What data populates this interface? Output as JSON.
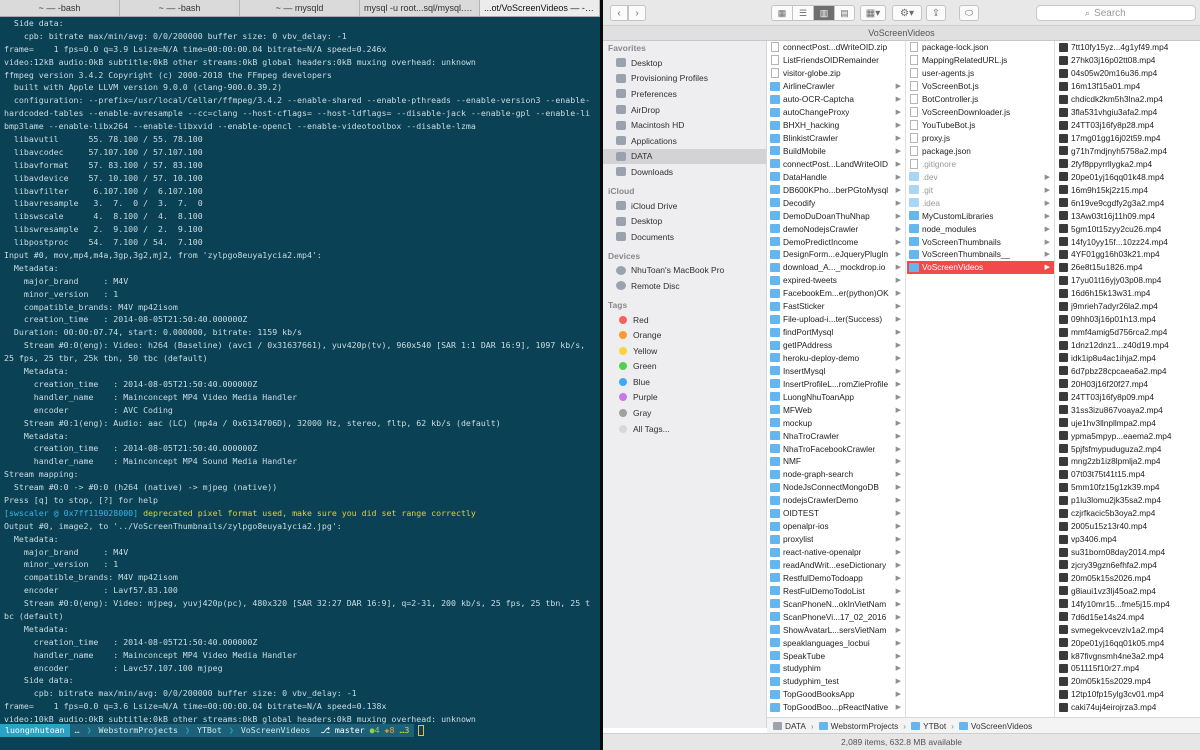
{
  "terminal": {
    "tabs": [
      "~ — -bash",
      "~ — -bash",
      "~ — mysqld",
      "mysql -u root...sql/mysql.sock",
      "...ot/VoScreenVideos — -bash"
    ],
    "lines": [
      "  Side data:",
      "    cpb: bitrate max/min/avg: 0/0/200000 buffer size: 0 vbv_delay: -1",
      "frame=    1 fps=0.0 q=3.9 Lsize=N/A time=00:00:00.04 bitrate=N/A speed=0.246x",
      "video:12kB audio:0kB subtitle:0kB other streams:0kB global headers:0kB muxing overhead: unknown",
      "ffmpeg version 3.4.2 Copyright (c) 2000-2018 the FFmpeg developers",
      "  built with Apple LLVM version 9.0.0 (clang-900.0.39.2)",
      "  configuration: --prefix=/usr/local/Cellar/ffmpeg/3.4.2 --enable-shared --enable-pthreads --enable-version3 --enable-",
      "hardcoded-tables --enable-avresample --cc=clang --host-cflags= --host-ldflags= --disable-jack --enable-gpl --enable-li",
      "bmp3lame --enable-libx264 --enable-libxvid --enable-opencl --enable-videotoolbox --disable-lzma",
      "  libavutil      55. 78.100 / 55. 78.100",
      "  libavcodec     57.107.100 / 57.107.100",
      "  libavformat    57. 83.100 / 57. 83.100",
      "  libavdevice    57. 10.100 / 57. 10.100",
      "  libavfilter     6.107.100 /  6.107.100",
      "  libavresample   3.  7.  0 /  3.  7.  0",
      "  libswscale      4.  8.100 /  4.  8.100",
      "  libswresample   2.  9.100 /  2.  9.100",
      "  libpostproc    54.  7.100 / 54.  7.100",
      "Input #0, mov,mp4,m4a,3gp,3g2,mj2, from 'zylpgo8euya1ycia2.mp4':",
      "  Metadata:",
      "    major_brand     : M4V",
      "    minor_version   : 1",
      "    compatible_brands: M4V mp42isom",
      "    creation_time   : 2014-08-05T21:50:40.000000Z",
      "  Duration: 00:00:07.74, start: 0.000000, bitrate: 1159 kb/s",
      "    Stream #0:0(eng): Video: h264 (Baseline) (avc1 / 0x31637661), yuv420p(tv), 960x540 [SAR 1:1 DAR 16:9], 1097 kb/s,",
      "25 fps, 25 tbr, 25k tbn, 50 tbc (default)",
      "    Metadata:",
      "      creation_time   : 2014-08-05T21:50:40.000000Z",
      "      handler_name    : Mainconcept MP4 Video Media Handler",
      "      encoder         : AVC Coding",
      "    Stream #0:1(eng): Audio: aac (LC) (mp4a / 0x6134706D), 32000 Hz, stereo, fltp, 62 kb/s (default)",
      "    Metadata:",
      "      creation_time   : 2014-08-05T21:50:40.000000Z",
      "      handler_name    : Mainconcept MP4 Sound Media Handler",
      "Stream mapping:",
      "  Stream #0:0 -> #0:0 (h264 (native) -> mjpeg (native))",
      "Press [q] to stop, [?] for help"
    ],
    "warn_prefix": "[swscaler @ 0x7ff119028000]",
    "warn_text": " deprecated pixel format used, make sure you did set range correctly",
    "lines2": [
      "Output #0, image2, to '../VoScreenThumbnails/zylpgo8euya1ycia2.jpg':",
      "  Metadata:",
      "    major_brand     : M4V",
      "    minor_version   : 1",
      "    compatible_brands: M4V mp42isom",
      "    encoder         : Lavf57.83.100",
      "    Stream #0:0(eng): Video: mjpeg, yuvj420p(pc), 480x320 [SAR 32:27 DAR 16:9], q=2-31, 200 kb/s, 25 fps, 25 tbn, 25 t",
      "bc (default)",
      "    Metadata:",
      "      creation_time   : 2014-08-05T21:50:40.000000Z",
      "      handler_name    : Mainconcept MP4 Video Media Handler",
      "      encoder         : Lavc57.107.100 mjpeg",
      "    Side data:",
      "      cpb: bitrate max/min/avg: 0/0/200000 buffer size: 0 vbv_delay: -1",
      "frame=    1 fps=0.0 q=3.6 Lsize=N/A time=00:00:00.04 bitrate=N/A speed=0.138x",
      "video:10kB audio:0kB subtitle:0kB other streams:0kB global headers:0kB muxing overhead: unknown"
    ],
    "prompt": {
      "user": "luongnhutoan",
      "path": [
        "…",
        "WebstormProjects",
        "YTBot",
        "VoScreenVideos"
      ],
      "branch": "master",
      "ok": "4",
      "mod": "8",
      "untracked": "3"
    }
  },
  "finder": {
    "window_title": "VoScreenVideos",
    "search_placeholder": "Search",
    "sidebar": {
      "favorites_label": "Favorites",
      "favorites": [
        "Desktop",
        "Provisioning Profiles",
        "Preferences",
        "AirDrop",
        "Macintosh HD",
        "Applications",
        "DATA",
        "Downloads"
      ],
      "icloud_label": "iCloud",
      "icloud": [
        "iCloud Drive",
        "Desktop",
        "Documents"
      ],
      "devices_label": "Devices",
      "devices": [
        "NhuToan's MacBook Pro",
        "Remote Disc"
      ],
      "tags_label": "Tags",
      "tags": [
        {
          "name": "Red",
          "color": "#fc605b"
        },
        {
          "name": "Orange",
          "color": "#fd9a30"
        },
        {
          "name": "Yellow",
          "color": "#fcd33c"
        },
        {
          "name": "Green",
          "color": "#4fd14f"
        },
        {
          "name": "Blue",
          "color": "#3fa9f5"
        },
        {
          "name": "Purple",
          "color": "#c57ae8"
        },
        {
          "name": "Gray",
          "color": "#a0a0a0"
        },
        {
          "name": "All Tags...",
          "color": "#d8d8d8"
        }
      ]
    },
    "col1": [
      {
        "n": "connectPost...dWriteOID.zip",
        "t": "file"
      },
      {
        "n": "ListFriendsOIDRemainder",
        "t": "file"
      },
      {
        "n": "visitor-globe.zip",
        "t": "file"
      },
      {
        "n": "AirlineCrawler",
        "t": "folder"
      },
      {
        "n": "auto-OCR-Captcha",
        "t": "folder"
      },
      {
        "n": "autoChangeProxy",
        "t": "folder"
      },
      {
        "n": "BHXH_hacking",
        "t": "folder"
      },
      {
        "n": "BlinkistCrawler",
        "t": "folder"
      },
      {
        "n": "BuildMobile",
        "t": "folder"
      },
      {
        "n": "connectPost...LandWriteOID",
        "t": "folder"
      },
      {
        "n": "DataHandle",
        "t": "folder"
      },
      {
        "n": "DB600KPho...berPGtoMysql",
        "t": "folder"
      },
      {
        "n": "Decodify",
        "t": "folder"
      },
      {
        "n": "DemoDuDoanThuNhap",
        "t": "folder"
      },
      {
        "n": "demoNodejsCrawler",
        "t": "folder"
      },
      {
        "n": "DemoPredictIncome",
        "t": "folder"
      },
      {
        "n": "DesignForm...eJqueryPlugIn",
        "t": "folder"
      },
      {
        "n": "download_A..._mockdrop.io",
        "t": "folder"
      },
      {
        "n": "expired-tweets",
        "t": "folder"
      },
      {
        "n": "FacebookEm...er(python)OK",
        "t": "folder"
      },
      {
        "n": "FastSticker",
        "t": "folder"
      },
      {
        "n": "File-upload-i...ter(Success)",
        "t": "folder"
      },
      {
        "n": "findPortMysql",
        "t": "folder"
      },
      {
        "n": "getIPAddress",
        "t": "folder"
      },
      {
        "n": "heroku-deploy-demo",
        "t": "folder"
      },
      {
        "n": "InsertMysql",
        "t": "folder"
      },
      {
        "n": "InsertProfileL...romZieProfile",
        "t": "folder"
      },
      {
        "n": "LuongNhuToanApp",
        "t": "folder"
      },
      {
        "n": "MFWeb",
        "t": "folder"
      },
      {
        "n": "mockup",
        "t": "folder"
      },
      {
        "n": "NhaTroCrawler",
        "t": "folder"
      },
      {
        "n": "NhaTroFacebookCrawler",
        "t": "folder"
      },
      {
        "n": "NMF",
        "t": "folder"
      },
      {
        "n": "node-graph-search",
        "t": "folder"
      },
      {
        "n": "NodeJsConnectMongoDB",
        "t": "folder"
      },
      {
        "n": "nodejsCrawlerDemo",
        "t": "folder"
      },
      {
        "n": "OIDTEST",
        "t": "folder"
      },
      {
        "n": "openalpr-ios",
        "t": "folder"
      },
      {
        "n": "proxylist",
        "t": "folder"
      },
      {
        "n": "react-native-openalpr",
        "t": "folder"
      },
      {
        "n": "readAndWrit...eseDictionary",
        "t": "folder"
      },
      {
        "n": "RestfulDemoTodoapp",
        "t": "folder"
      },
      {
        "n": "RestFulDemoTodoList",
        "t": "folder"
      },
      {
        "n": "ScanPhoneN...okInVietNam",
        "t": "folder"
      },
      {
        "n": "ScanPhoneVi...17_02_2016",
        "t": "folder"
      },
      {
        "n": "ShowAvatarL...sersVietNam",
        "t": "folder"
      },
      {
        "n": "speaklanguages_locbui",
        "t": "folder"
      },
      {
        "n": "SpeakTube",
        "t": "folder"
      },
      {
        "n": "studyphim",
        "t": "folder"
      },
      {
        "n": "studyphim_test",
        "t": "folder"
      },
      {
        "n": "TopGoodBooksApp",
        "t": "folder"
      },
      {
        "n": "TopGoodBoo...pReactNative",
        "t": "folder"
      }
    ],
    "col2": [
      {
        "n": "package-lock.json",
        "t": "file"
      },
      {
        "n": "MappingRelatedURL.js",
        "t": "file"
      },
      {
        "n": "user-agents.js",
        "t": "file"
      },
      {
        "n": "VoScreenBot.js",
        "t": "file"
      },
      {
        "n": "BotController.js",
        "t": "file"
      },
      {
        "n": "VoScreenDownloader.js",
        "t": "file"
      },
      {
        "n": "YouTubeBot.js",
        "t": "file"
      },
      {
        "n": "proxy.js",
        "t": "file"
      },
      {
        "n": "package.json",
        "t": "file"
      },
      {
        "n": ".gitignore",
        "t": "file",
        "dim": true
      },
      {
        "n": ".dev",
        "t": "folder",
        "dim": true
      },
      {
        "n": ".git",
        "t": "folder",
        "dim": true
      },
      {
        "n": ".idea",
        "t": "folder",
        "dim": true
      },
      {
        "n": "MyCustomLibraries",
        "t": "folder"
      },
      {
        "n": "node_modules",
        "t": "folder"
      },
      {
        "n": "VoScreenThumbnails",
        "t": "folder"
      },
      {
        "n": "VoScreenThumbnails__",
        "t": "folder"
      },
      {
        "n": "VoScreenVideos",
        "t": "folder",
        "sel": true
      }
    ],
    "col3": [
      "7tt10fy15yz...4g1yf49.mp4",
      "27hk03j16p02tt08.mp4",
      "04s05w20m16u36.mp4",
      "16m13f15a01.mp4",
      "chdicdk2km5h3lna2.mp4",
      "3fla531vhgiu3afa2.mp4",
      "24TT03j16fy8p28.mp4",
      "17mg01gg16j02t59.mp4",
      "g71h7mdjnyh5758a2.mp4",
      "2fyf8ppyrrllygka2.mp4",
      "20pe01yj16qq01k48.mp4",
      "16m9h15kj2z15.mp4",
      "6n19ve9cgdfy2g3a2.mp4",
      "13Aw03t16j11h09.mp4",
      "5gm10t15zyy2cu26.mp4",
      "14fy10yy15f...10zz24.mp4",
      "4YF01gg16h03k21.mp4",
      "26e8t15u1826.mp4",
      "17yu01t16yjy03p08.mp4",
      "16d6h15k13w31.mp4",
      "j9mrieh7adyr26la2.mp4",
      "09hh03j16p01h13.mp4",
      "mmf4amig5d756rca2.mp4",
      "1dnz12dnz1...z40d19.mp4",
      "idk1ip8u4ac1ihja2.mp4",
      "6d7pbz28cpcaea6a2.mp4",
      "20H03j16f20f27.mp4",
      "24TT03j16fy8p09.mp4",
      "31ss3izu867voaya2.mp4",
      "uje1hv3llnpllmpa2.mp4",
      "ypma5mpyp...eaema2.mp4",
      "5pjfsfmypuduguza2.mp4",
      "mng2zb1iz8lpmlja2.mp4",
      "07t03t75t41t15.mp4",
      "5mm10fz15g1zk39.mp4",
      "p1lu3lomu2jk35sa2.mp4",
      "czjrfkacic5b3oya2.mp4",
      "2005u15z13r40.mp4",
      "vp3406.mp4",
      "su31born08day2014.mp4",
      "zjcry39gzn6efhfa2.mp4",
      "20m05k15s2026.mp4",
      "g8iaui1vz3lj45oa2.mp4",
      "14fy10mr15...fme5j15.mp4",
      "7d6d15e14s24.mp4",
      "svmegekvcevziv1a2.mp4",
      "20pe01yj16qq01k05.mp4",
      "k87fivgnsmh4ne3a2.mp4",
      "051115f10r27.mp4",
      "20m05k15s2029.mp4",
      "12tp10fp15ylg3cv01.mp4",
      "caki74uj4eirojrza3.mp4"
    ],
    "pathbar": [
      "DATA",
      "WebstormProjects",
      "YTBot",
      "VoScreenVideos"
    ],
    "status": "2,089 items, 632.8 MB available"
  }
}
